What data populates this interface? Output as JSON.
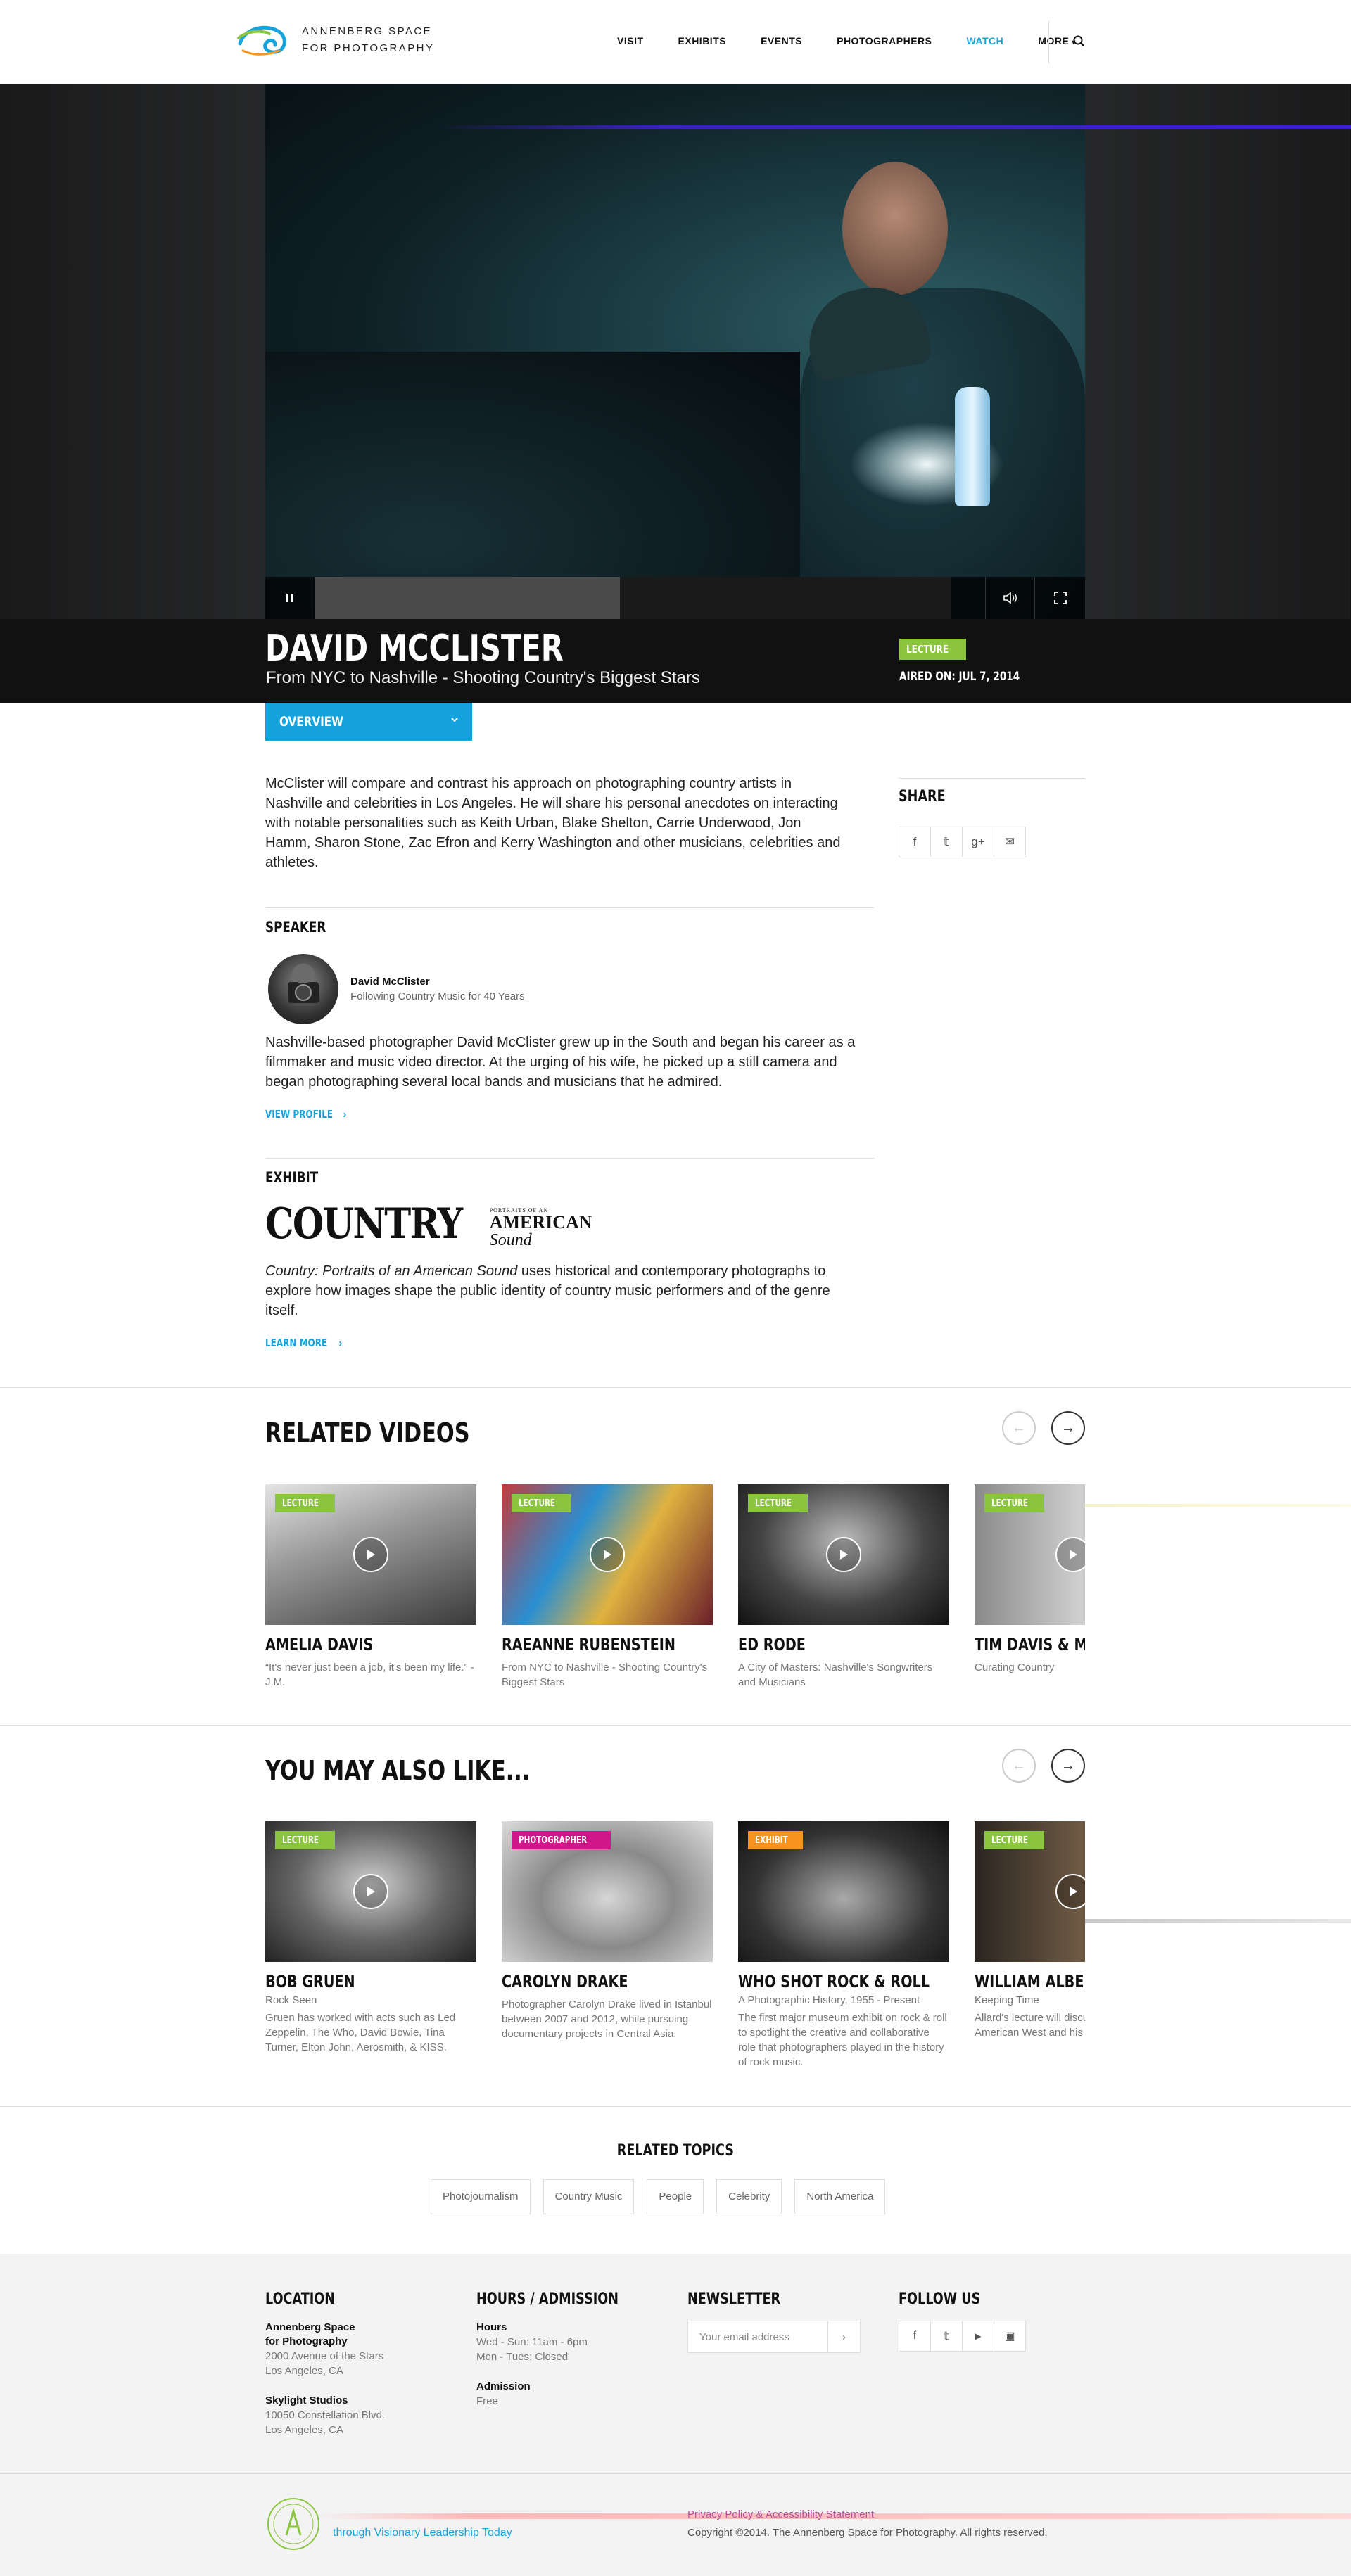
{
  "header": {
    "logo_line1": "Annenberg Space",
    "logo_line2": "for Photography",
    "nav": [
      "VISIT",
      "EXHIBITS",
      "EVENTS",
      "PHOTOGRAPHERS",
      "WATCH",
      "MORE"
    ],
    "active_nav": "WATCH"
  },
  "hero": {
    "title": "DAVID MCCLISTER",
    "subtitle": "From NYC to Nashville - Shooting Country's Biggest Stars",
    "badge": "LECTURE",
    "aired": "AIRED ON: JUL 7, 2014",
    "progress": 0.48
  },
  "overview": {
    "tab_label": "OVERVIEW",
    "text": "McClister will compare and contrast his approach on photographing country artists in Nashville and celebrities in Los Angeles. He will share his personal anecdotes on interacting with notable personalities such as Keith Urban, Blake Shelton, Carrie Underwood, Jon Hamm, Sharon Stone, Zac Efron and Kerry Washington and other musicians, celebrities and athletes."
  },
  "share": {
    "title": "SHARE",
    "icons": [
      "facebook-icon",
      "twitter-icon",
      "google-plus-icon",
      "email-icon"
    ]
  },
  "speaker": {
    "heading": "SPEAKER",
    "name": "David McClister",
    "role": "Following Country Music for 40 Years",
    "bio": "Nashville-based photographer David McClister grew up in the South and began his career as a filmmaker and music video director. At the urging of his wife, he picked up a still camera and began photographing several local bands and musicians that he admired.",
    "link": "VIEW PROFILE"
  },
  "exhibit": {
    "heading": "EXHIBIT",
    "logo_big": "COUNTRY",
    "logo_small": "PORTRAITS OF AN",
    "logo_american": "AMERICAN",
    "logo_sound": "Sound",
    "title_italic": "Country: Portraits of an American Sound",
    "text": " uses historical and contemporary photographs to explore how images shape the public identity of country music performers and of the genre itself.",
    "link": "LEARN MORE"
  },
  "related": {
    "heading": "RELATED VIDEOS",
    "cards": [
      {
        "badge": "LECTURE",
        "title": "AMELIA DAVIS",
        "desc": "“It's never just been a job, it's been my life.” -J.M."
      },
      {
        "badge": "LECTURE",
        "title": "RAEANNE RUBENSTEIN",
        "desc": "From NYC to Nashville - Shooting Country's Biggest Stars"
      },
      {
        "badge": "LECTURE",
        "title": "ED RODE",
        "desc": "A City of Masters: Nashville's Songwriters and Musicians"
      },
      {
        "badge": "LECTURE",
        "title": "TIM DAVIS & MICHAEL",
        "desc": "Curating Country"
      }
    ]
  },
  "also_like": {
    "heading": "YOU MAY ALSO LIKE...",
    "cards": [
      {
        "badge": "LECTURE",
        "badge_color": "#8bc53f",
        "title": "BOB GRUEN",
        "sub": "Rock Seen",
        "desc": "Gruen has worked with acts such as Led Zeppelin, The Who, David Bowie, Tina Turner, Elton John, Aerosmith, & KISS."
      },
      {
        "badge": "PHOTOGRAPHER",
        "badge_color": "#d0168a",
        "title": "CAROLYN DRAKE",
        "sub": "",
        "desc": "Photographer Carolyn Drake lived in Istanbul between 2007 and 2012, while pursuing documentary projects in Central Asia."
      },
      {
        "badge": "EXHIBIT",
        "badge_color": "#f7941d",
        "title": "WHO SHOT ROCK & ROLL",
        "sub": "A Photographic History, 1955 - Present",
        "desc": "The first major museum exhibit on rock & roll to spotlight the creative and collaborative role that photographers played in the history of rock music."
      },
      {
        "badge": "LECTURE",
        "badge_color": "#8bc53f",
        "title": "WILLIAM ALBERT ALLARD",
        "sub": "Keeping Time",
        "desc": "Allard's lecture will discuss work done on the American West and his continuing career."
      }
    ]
  },
  "topics": {
    "heading": "RELATED TOPICS",
    "items": [
      "Photojournalism",
      "Country Music",
      "People",
      "Celebrity",
      "North America"
    ]
  },
  "footer": {
    "location": {
      "heading": "LOCATION",
      "place1_name1": "Annenberg Space",
      "place1_name2": "for Photography",
      "place1_addr1": "2000 Avenue of the Stars",
      "place1_addr2": "Los Angeles, CA",
      "place2_name": "Skylight Studios",
      "place2_addr1": "10050 Constellation Blvd.",
      "place2_addr2": "Los Angeles, CA"
    },
    "hours": {
      "heading": "HOURS / ADMISSION",
      "hours_label": "Hours",
      "hours1": "Wed - Sun: 11am - 6pm",
      "hours2": "Mon - Tues: Closed",
      "admission_label": "Admission",
      "admission": "Free"
    },
    "newsletter": {
      "heading": "NEWSLETTER",
      "placeholder": "Your email address"
    },
    "follow": {
      "heading": "FOLLOW US",
      "icons": [
        "facebook-icon",
        "twitter-icon",
        "youtube-icon",
        "instagram-icon"
      ]
    },
    "tagline2": "through Visionary Leadership Today",
    "legal": "Privacy Policy & Accessibility Statement",
    "copyright": "Copyright ©2014. The Annenberg Space for Photography. All rights reserved."
  }
}
